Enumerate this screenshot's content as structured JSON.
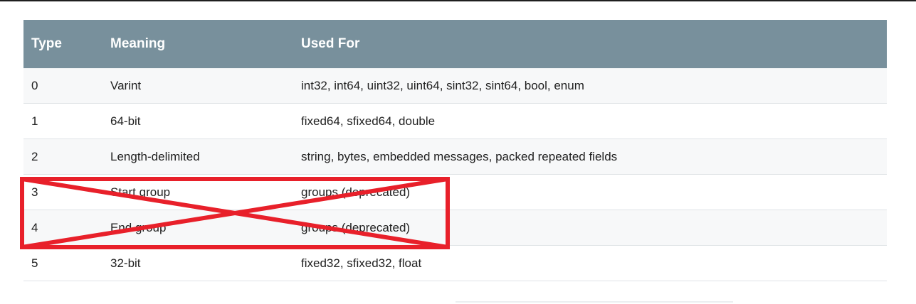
{
  "table": {
    "headers": {
      "type": "Type",
      "meaning": "Meaning",
      "used_for": "Used For"
    },
    "rows": [
      {
        "type": "0",
        "meaning": "Varint",
        "used_for": "int32, int64, uint32, uint64, sint32, sint64, bool, enum"
      },
      {
        "type": "1",
        "meaning": "64-bit",
        "used_for": "fixed64, sfixed64, double"
      },
      {
        "type": "2",
        "meaning": "Length-delimited",
        "used_for": "string, bytes, embedded messages, packed repeated fields"
      },
      {
        "type": "3",
        "meaning": "Start group",
        "used_for": "groups (deprecated)"
      },
      {
        "type": "4",
        "meaning": "End group",
        "used_for": "groups (deprecated)"
      },
      {
        "type": "5",
        "meaning": "32-bit",
        "used_for": "fixed32, sfixed32, float"
      }
    ],
    "colors": {
      "header_bg": "#78909c",
      "row_shade": "#f7f8f9",
      "annotation": "#e8202a"
    }
  },
  "annotation": {
    "kind": "red-box-with-x",
    "covers_rows": [
      "3",
      "4"
    ]
  }
}
